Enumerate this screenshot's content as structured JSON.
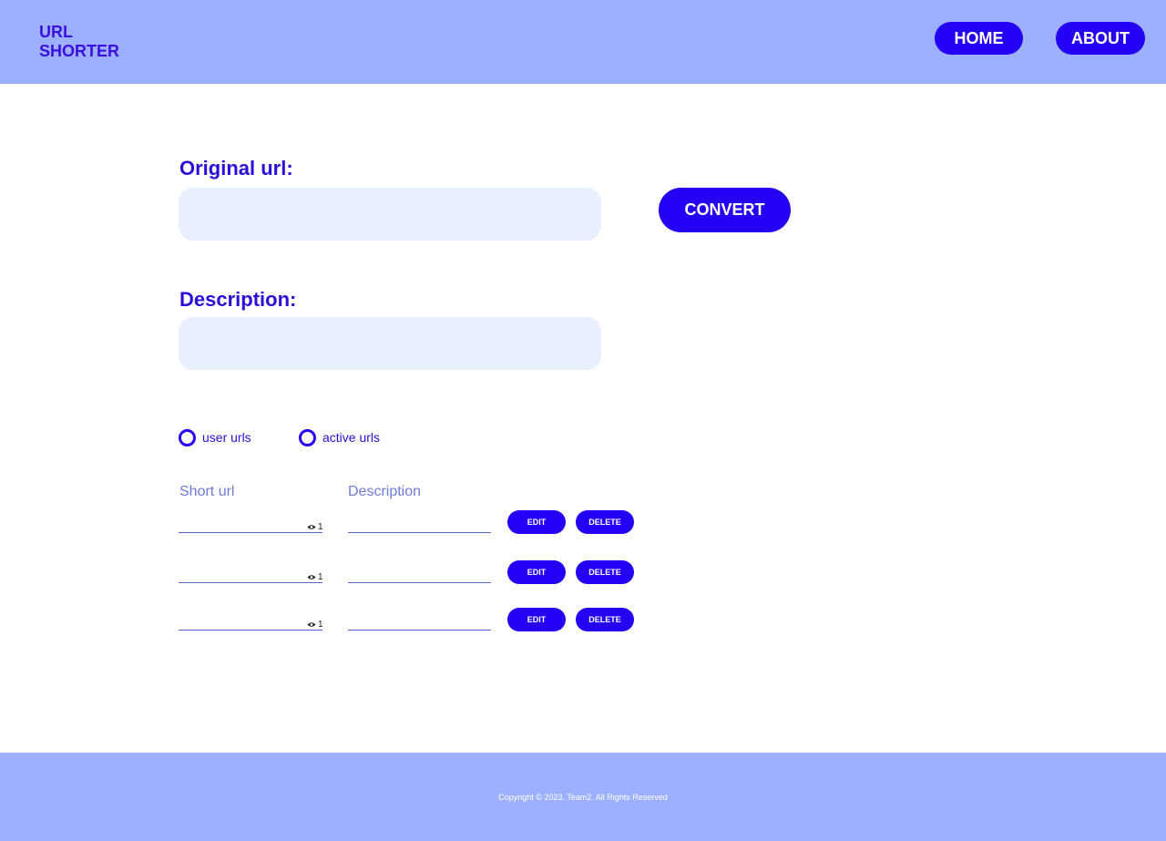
{
  "header": {
    "logo_line1": "URL",
    "logo_line2": "SHORTER",
    "nav": {
      "home": "HOME",
      "about": "ABOUT"
    }
  },
  "form": {
    "original_url_label": "Original url:",
    "original_url_value": "",
    "convert_label": "CONVERT",
    "description_label": "Description:",
    "description_value": ""
  },
  "filters": {
    "user_urls": "user urls",
    "active_urls": "active urls"
  },
  "table": {
    "headers": {
      "short_url": "Short url",
      "description": "Description"
    },
    "rows": [
      {
        "short_url": "",
        "views": "1",
        "description": "",
        "edit": "EDIT",
        "delete": "DELETE"
      },
      {
        "short_url": "",
        "views": "1",
        "description": "",
        "edit": "EDIT",
        "delete": "DELETE"
      },
      {
        "short_url": "",
        "views": "1",
        "description": "",
        "edit": "EDIT",
        "delete": "DELETE"
      }
    ]
  },
  "footer": {
    "copyright": "Copyright © 2023. Team2. All Rights Reserved"
  },
  "colors": {
    "header_bg": "#9cb0ff",
    "accent": "#2400f5",
    "label": "#2a0fd8",
    "field_bg": "#e8effd"
  }
}
